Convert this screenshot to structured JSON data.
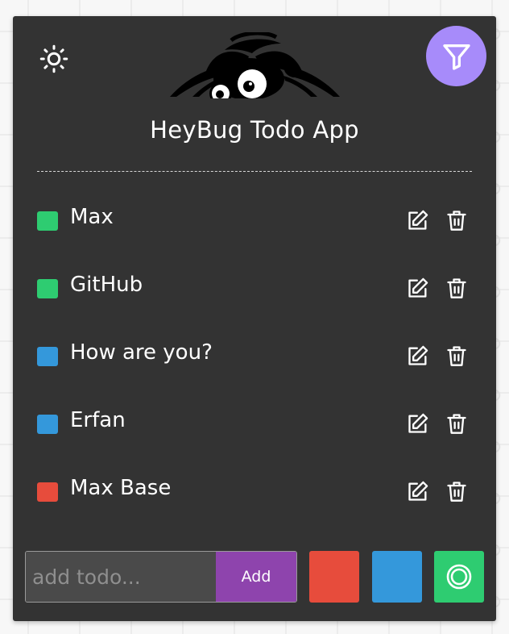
{
  "app": {
    "title": "HeyBug Todo App",
    "logo_icon": "bug-logo-icon",
    "theme_toggle_icon": "sun-icon",
    "filter_icon": "filter-icon"
  },
  "colors": {
    "card_background": "#333333",
    "filter_button": "#a78bfa",
    "add_button": "#8e44ad",
    "green": "#2ecc71",
    "blue": "#3498db",
    "red": "#e74c3c"
  },
  "todos": [
    {
      "text": "Max",
      "color": "#2ecc71"
    },
    {
      "text": "GitHub",
      "color": "#2ecc71"
    },
    {
      "text": "How are you?",
      "color": "#3498db"
    },
    {
      "text": "Erfan",
      "color": "#3498db"
    },
    {
      "text": "Max Base",
      "color": "#e74c3c"
    }
  ],
  "todo_actions": {
    "edit_icon": "edit-icon",
    "delete_icon": "trash-icon"
  },
  "add_form": {
    "placeholder": "add todo...",
    "value": "",
    "button_label": "Add"
  },
  "color_picker": [
    {
      "name": "red",
      "color": "#e74c3c",
      "selected": false
    },
    {
      "name": "blue",
      "color": "#3498db",
      "selected": false
    },
    {
      "name": "green",
      "color": "#2ecc71",
      "selected": true
    }
  ]
}
